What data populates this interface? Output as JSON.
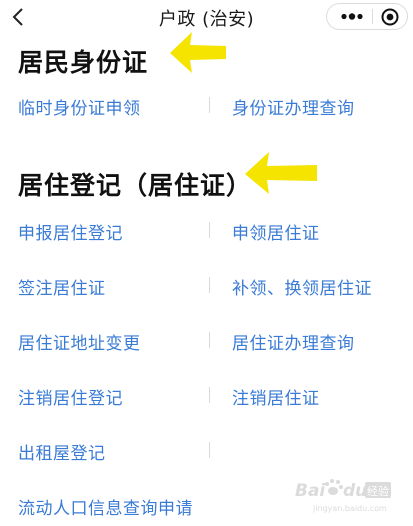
{
  "nav": {
    "title": "户政 (治安)",
    "back_icon": "chevron-left-icon",
    "more_icon": "more-dots-icon",
    "close_icon": "record-close-icon"
  },
  "sections": [
    {
      "title": "居民身份证",
      "items": [
        "临时身份证申领",
        "身份证办理查询"
      ]
    },
    {
      "title": "居住登记（居住证）",
      "items": [
        "申报居住登记",
        "申领居住证",
        "签注居住证",
        "补领、换领居住证",
        "居住证地址变更",
        "居住证办理查询",
        "注销居住登记",
        "注销居住证",
        "出租屋登记",
        "流动人口信息查询申请"
      ]
    }
  ],
  "colors": {
    "link": "#3a7bd5",
    "arrow": "#f5e400",
    "heading": "#111111"
  },
  "watermark": {
    "icon": "baidu-jingyan-logo",
    "text": "Bai du 经验",
    "subtext": "jingyan.baidu.com"
  }
}
